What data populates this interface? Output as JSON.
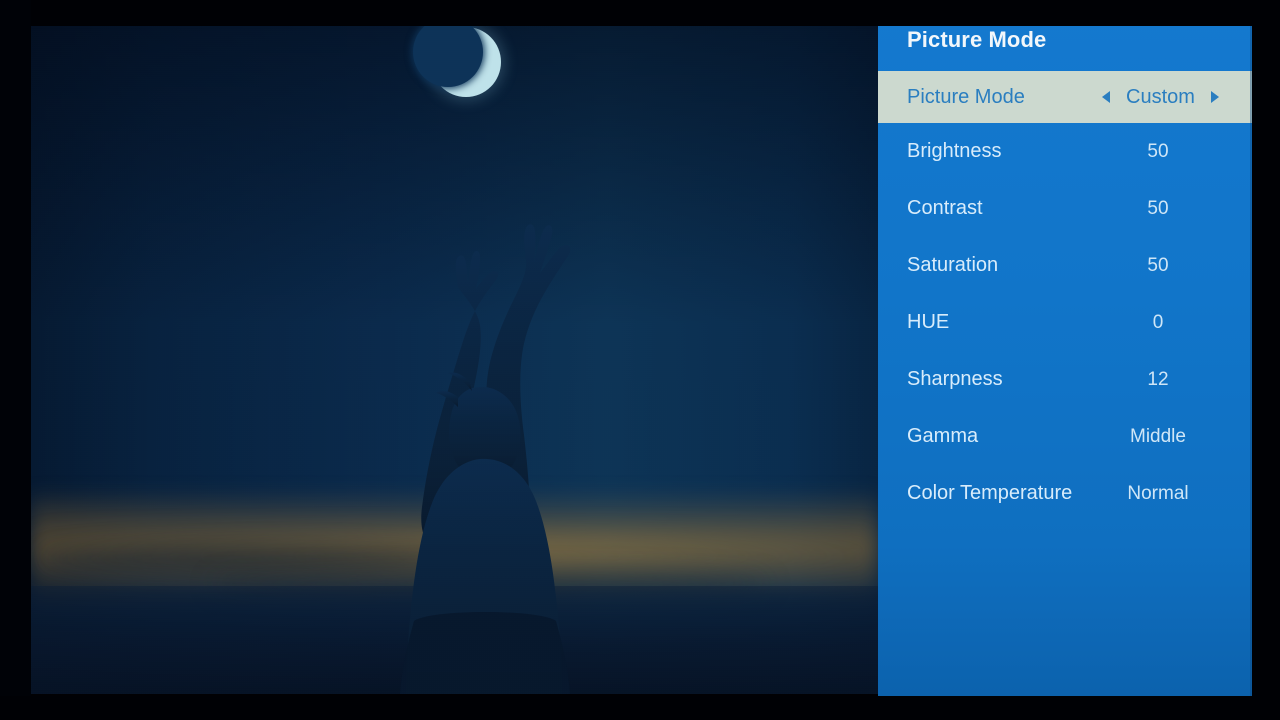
{
  "device": {
    "screen_type": "tv-projector-osd",
    "bezel_color": "#000105"
  },
  "osd": {
    "header": {
      "title": "Picture Mode"
    },
    "accent_color": "#1175c9",
    "highlight_bg": "#ccd9cf",
    "highlight_text": "#2a7ec0",
    "label_color": "#d8ecfb",
    "rows": [
      {
        "label": "Picture Mode",
        "value": "Custom",
        "selected": true,
        "has_arrows": true
      },
      {
        "label": "Brightness",
        "value": "50",
        "selected": false,
        "has_arrows": false
      },
      {
        "label": "Contrast",
        "value": "50",
        "selected": false,
        "has_arrows": false
      },
      {
        "label": "Saturation",
        "value": "50",
        "selected": false,
        "has_arrows": false
      },
      {
        "label": "HUE",
        "value": "0",
        "selected": false,
        "has_arrows": false
      },
      {
        "label": "Sharpness",
        "value": "12",
        "selected": false,
        "has_arrows": false
      },
      {
        "label": "Gamma",
        "value": "Middle",
        "selected": false,
        "has_arrows": false
      },
      {
        "label": "Color Temperature",
        "value": "Normal",
        "selected": false,
        "has_arrows": false
      }
    ],
    "arrows": {
      "left_icon": "arrow-left-icon",
      "right_icon": "arrow-right-icon"
    }
  },
  "video": {
    "description": "Silhouette of a person with raised arms against a blue twilight sky with a crescent moon",
    "moon_icon": "crescent-moon",
    "sky_top_color": "#0b2746",
    "sky_mid_color": "#1a7fae",
    "horizon_glow_color": "#b07e32",
    "ground_color": "#0a1f39",
    "silhouette_color": "#0a2440"
  }
}
